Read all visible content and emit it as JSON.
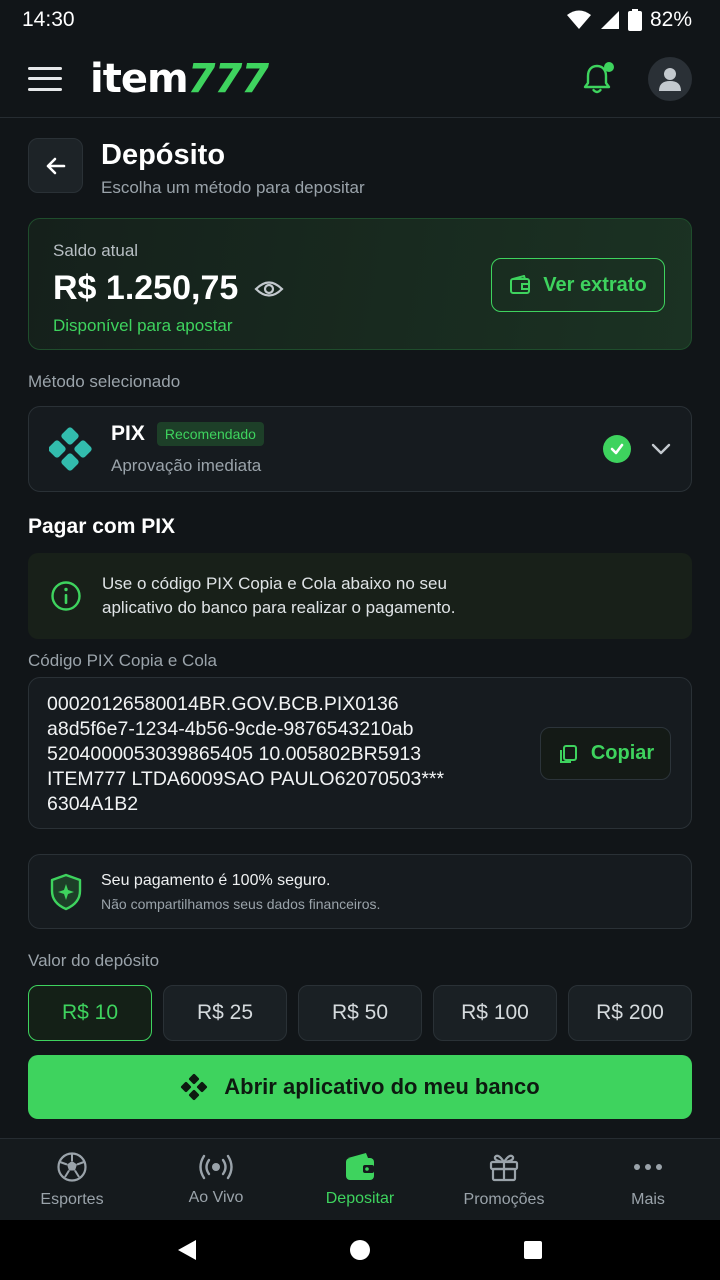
{
  "status": {
    "time": "14:30",
    "battery": "82%"
  },
  "header": {
    "logo_white": "item",
    "logo_green": "777"
  },
  "page": {
    "title": "Depósito",
    "subtitle": "Escolha um método para depositar"
  },
  "balance": {
    "label": "Saldo atual",
    "value": "R$ 1.250,75",
    "available": "Disponível para apostar",
    "extrato_label": "Ver extrato"
  },
  "method": {
    "section_label": "Método selecionado",
    "name": "PIX",
    "badge": "Recomendado",
    "subtitle": "Aprovação imediata"
  },
  "pix": {
    "title": "Pagar com PIX",
    "info": "Use o código PIX Copia e Cola abaixo no seu aplicativo do banco para realizar o pagamento.",
    "code_label": "Código PIX Copia e Cola",
    "code_lines": [
      "00020126580014BR.GOV.BCB.PIX0136",
      "a8d5f6e7-1234-4b56-9cde-9876543210ab",
      "5204000053039865405 10.005802BR5913",
      "ITEM777 LTDA6009SAO PAULO62070503***",
      "6304A1B2"
    ],
    "copy_label": "Copiar"
  },
  "secure": {
    "title": "Seu pagamento é 100% seguro.",
    "subtitle": "Não compartilhamos seus dados financeiros."
  },
  "amounts": {
    "label": "Valor do depósito",
    "options": [
      "R$ 10",
      "R$ 25",
      "R$ 50",
      "R$ 100",
      "R$ 200"
    ],
    "selected": "R$ 10"
  },
  "cta": {
    "label": "Abrir aplicativo do meu banco"
  },
  "nav": {
    "items": [
      {
        "label": "Esportes",
        "icon": "soccer-ball-icon"
      },
      {
        "label": "Ao Vivo",
        "icon": "live-broadcast-icon"
      },
      {
        "label": "Depositar",
        "icon": "wallet-icon"
      },
      {
        "label": "Promoções",
        "icon": "gift-icon"
      },
      {
        "label": "Mais",
        "icon": "more-dots-icon"
      }
    ],
    "active": "Depositar"
  },
  "colors": {
    "accent": "#3ed35e",
    "background": "#111518",
    "card": "#161b1f"
  }
}
